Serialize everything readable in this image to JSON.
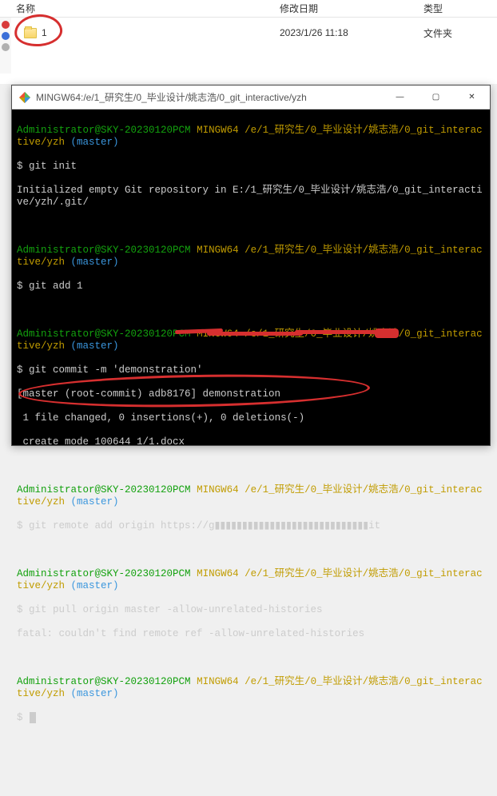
{
  "explorer": {
    "headers": {
      "name": "名称",
      "date": "修改日期",
      "type": "类型"
    },
    "file": {
      "name": "1",
      "date": "2023/1/26 11:18",
      "type": "文件夹"
    }
  },
  "terminal": {
    "title": "MINGW64:/e/1_研究生/0_毕业设计/姚志浩/0_git_interactive/yzh",
    "prompt_user": "Administrator@SKY-20230120PCM",
    "prompt_env": "MINGW64",
    "prompt_path": "/e/1_研究生/0_毕业设计/姚志浩/0_git_interactive/yzh",
    "prompt_branch": "(master)",
    "lines": {
      "l1": "$ git init",
      "l2": "Initialized empty Git repository in E:/1_研究生/0_毕业设计/姚志浩/0_git_interactive/yzh/.git/",
      "l3": "$ git add 1",
      "l4": "$ git commit -m 'demonstration'",
      "l5": "[master (root-commit) adb8176] demonstration",
      "l6": " 1 file changed, 0 insertions(+), 0 deletions(-)",
      "l7": " create mode 100644 1/1.docx",
      "l8": "$ git remote add origin https://g▮▮▮▮▮▮▮▮▮▮▮▮▮▮▮▮▮▮▮▮▮▮▮▮▮▮▮▮it",
      "l9": "$ git pull origin master -allow-unrelated-histories",
      "l10": "fatal: couldn't find remote ref -allow-unrelated-histories",
      "l11": "$ "
    }
  },
  "window_buttons": {
    "min": "—",
    "max": "▢",
    "close": "✕"
  },
  "colors": {
    "green": "#13a10e",
    "yellow": "#c19c00",
    "cyan": "#3a96dd",
    "red": "#d62f2f"
  }
}
